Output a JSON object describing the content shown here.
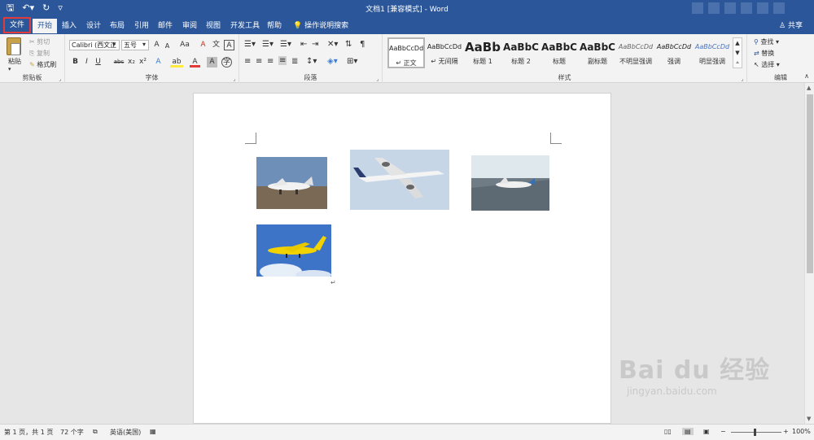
{
  "titlebar": {
    "title": "文档1 [兼容模式] - Word",
    "qat": {
      "save": "🖫",
      "undo": "↶▾",
      "redo": "↻",
      "customize": "▿"
    }
  },
  "tabs": [
    "文件",
    "开始",
    "插入",
    "设计",
    "布局",
    "引用",
    "邮件",
    "审阅",
    "视图",
    "开发工具",
    "帮助"
  ],
  "tellme": {
    "icon": "💡",
    "label": "操作说明搜索"
  },
  "share": {
    "icon": "♙",
    "label": "共享"
  },
  "ribbon": {
    "clipboard": {
      "label": "剪贴板",
      "paste": "粘贴",
      "cut": "剪切",
      "copy": "复制",
      "format_painter": "格式刷"
    },
    "font": {
      "label": "字体",
      "font_name": "Calibri (西文正",
      "font_size": "五号",
      "grow": "A",
      "shrink": "A",
      "case": "Aa",
      "clear": "A",
      "phonetic": "文",
      "charborder": "A",
      "bold": "B",
      "italic": "I",
      "underline": "U",
      "strike": "abc",
      "sub": "x₂",
      "sup": "x²",
      "effects": "A",
      "highlight": "ab",
      "color": "A",
      "shade": "A",
      "circled": "字"
    },
    "paragraph": {
      "label": "段落"
    },
    "styles": {
      "label": "样式",
      "items": [
        {
          "sample": "AaBbCcDd",
          "name": "↵ 正文"
        },
        {
          "sample": "AaBbCcDd",
          "name": "↵ 无间隔"
        },
        {
          "sample": "AaBb",
          "name": "标题 1"
        },
        {
          "sample": "AaBbC",
          "name": "标题 2"
        },
        {
          "sample": "AaBbC",
          "name": "标题"
        },
        {
          "sample": "AaBbC",
          "name": "副标题"
        },
        {
          "sample": "AaBbCcDd",
          "name": "不明显强调"
        },
        {
          "sample": "AaBbCcDd",
          "name": "强调"
        },
        {
          "sample": "AaBbCcDd",
          "name": "明显强调"
        }
      ]
    },
    "editing": {
      "label": "编辑",
      "find": "查找",
      "replace": "替换",
      "select": "选择"
    }
  },
  "document": {
    "paragraph_mark": "↵"
  },
  "status": {
    "page": "第 1 页，共 1 页",
    "words": "72 个字",
    "language": "英语(美国)",
    "zoom_minus": "−",
    "zoom_plus": "+",
    "zoom": "100%"
  },
  "watermark": {
    "brand": "Bai du 经验",
    "url": "jingyan.baidu.com"
  },
  "colors": {
    "titlebar": "#2b579a",
    "ribbon": "#f3f3f3",
    "file_highlight": "#e23b3b"
  }
}
